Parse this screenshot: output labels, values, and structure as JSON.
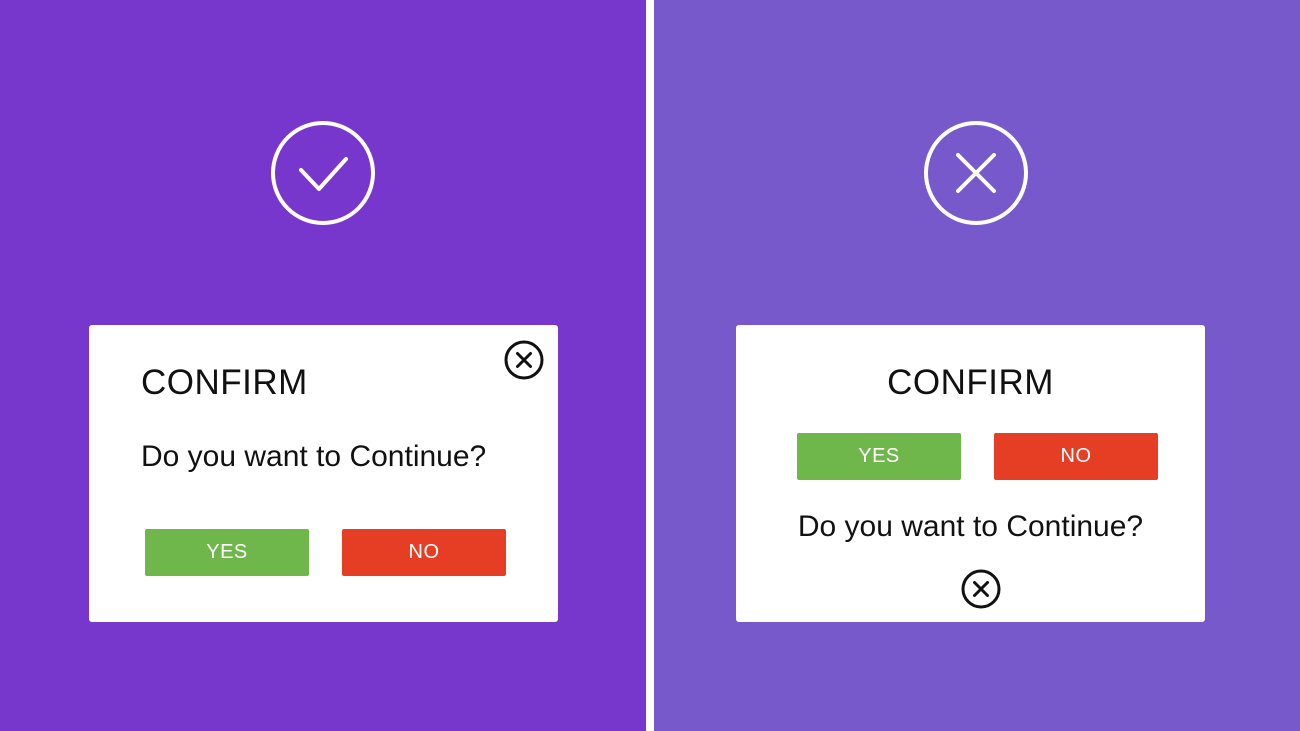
{
  "colors": {
    "left_background": "#7737cc",
    "right_background": "#7759cb",
    "divider": "#ffffff",
    "dialog": "#ffffff",
    "yes_button": "#6fb74b",
    "no_button": "#e53e25",
    "text": "#111111"
  },
  "left": {
    "badge_icon": "checkmark-circle-icon",
    "dialog": {
      "title": "CONFIRM",
      "message": "Do you want to Continue?",
      "yes_label": "YES",
      "no_label": "NO",
      "close_icon": "close-circle-icon"
    }
  },
  "right": {
    "badge_icon": "x-circle-icon",
    "dialog": {
      "title": "CONFIRM",
      "yes_label": "YES",
      "no_label": "NO",
      "message": "Do you want to Continue?",
      "close_icon": "close-circle-icon"
    }
  }
}
